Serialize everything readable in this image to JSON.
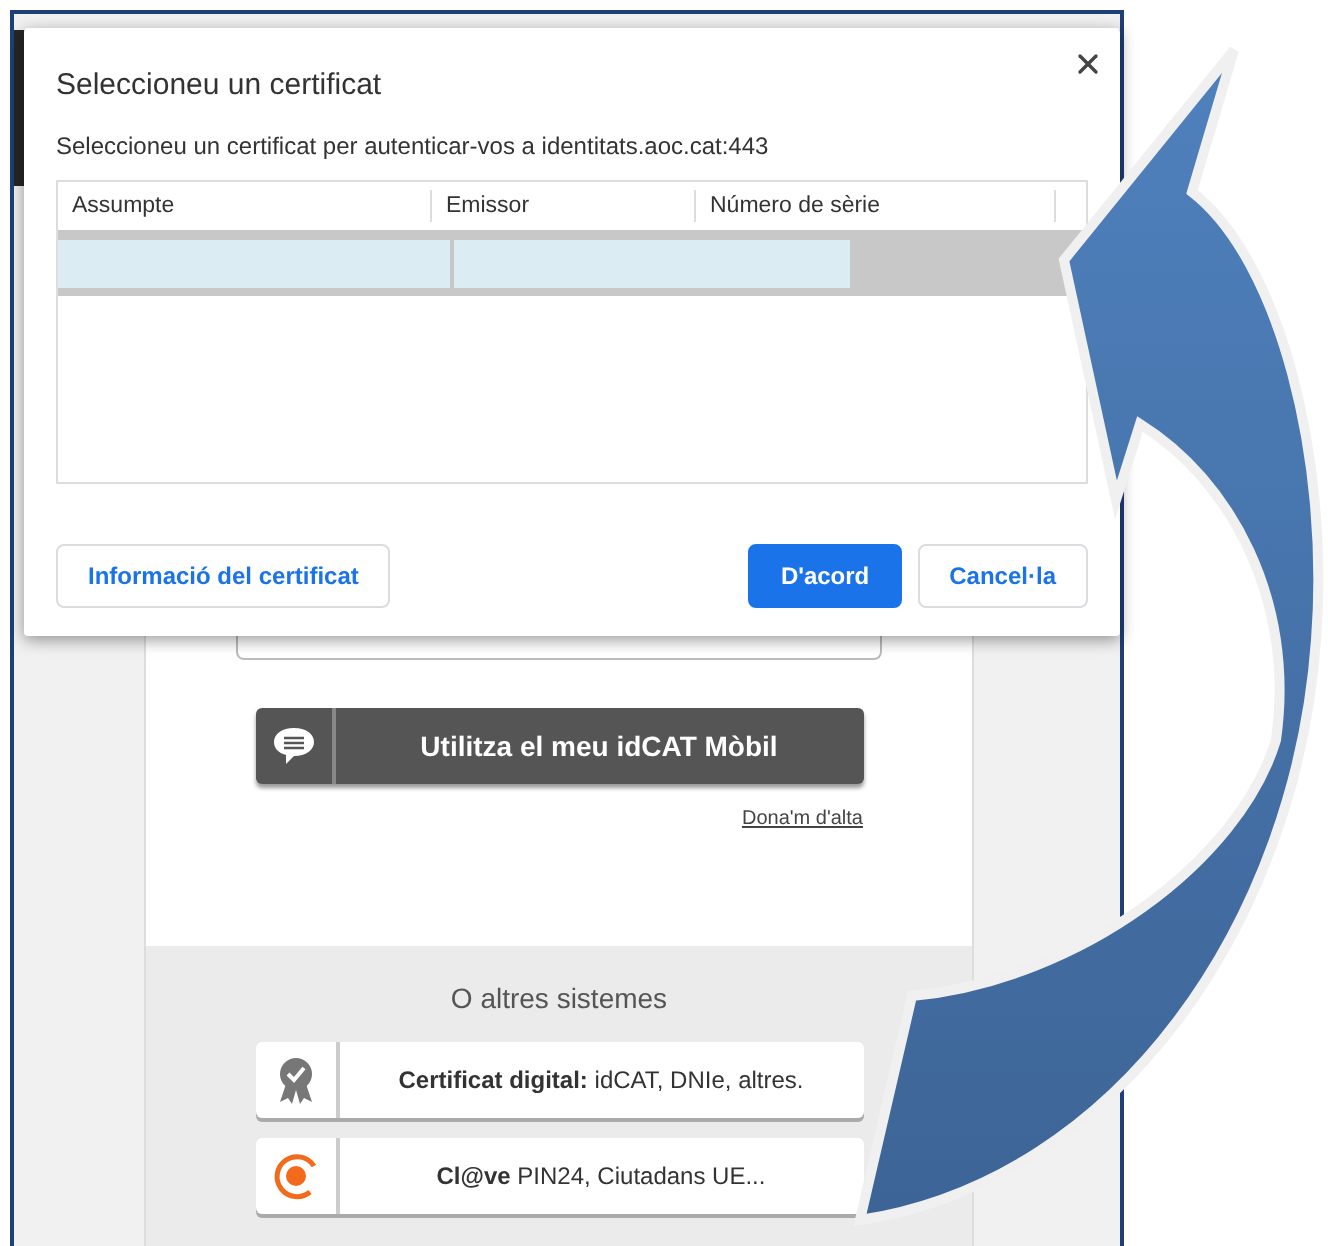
{
  "dialog": {
    "title": "Seleccioneu un certificat",
    "message": "Seleccioneu un certificat per autenticar-vos a identitats.aoc.cat:443",
    "columns": [
      "Assumpte",
      "Emissor",
      "Número de sèrie"
    ],
    "rows": [
      {
        "selected": true
      }
    ],
    "buttons": [
      {
        "label": "Informació del certificat",
        "kind": "secondary"
      },
      {
        "label": "D'acord",
        "kind": "primary"
      },
      {
        "label": "Cancel·la",
        "kind": "secondary"
      }
    ]
  },
  "page": {
    "mobile_button": "Utilitza el meu idCAT Mòbil",
    "signup_link": "Dona'm d'alta",
    "other_title": "O altres sistemes",
    "options": [
      {
        "kind": "certificate",
        "label": "**Certificat digital:** idCAT, DNIe, altres."
      },
      {
        "kind": "clave",
        "label": "**Cl@ve** PIN24, Ciutadans UE..."
      }
    ]
  }
}
